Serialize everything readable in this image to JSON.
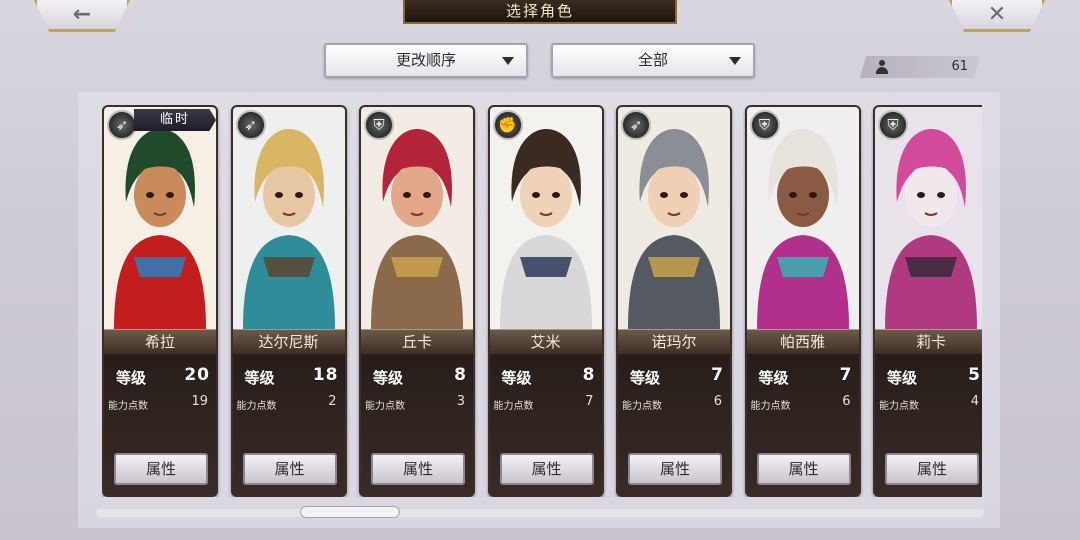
{
  "header": {
    "title": "选择角色",
    "back_icon": "←",
    "close_icon": "✕"
  },
  "controls": {
    "order_label": "更改顺序",
    "filter_label": "全部",
    "character_count": "61"
  },
  "characters": [
    {
      "name": "希拉",
      "level_label": "等级",
      "level": "20",
      "points_label": "能力点数",
      "points": "19",
      "attr_label": "属性",
      "class_icon": "bow-icon",
      "badge": "临时",
      "palette": {
        "bg": "#f5efe6",
        "hair": "#1f4a2c",
        "skin": "#c98a5c",
        "cloth": "#c21e1e",
        "accent": "#2a7fc0"
      }
    },
    {
      "name": "达尔尼斯",
      "level_label": "等级",
      "level": "18",
      "points_label": "能力点数",
      "points": "2",
      "attr_label": "属性",
      "class_icon": "bow-icon",
      "palette": {
        "bg": "#eef0f0",
        "hair": "#d9b664",
        "skin": "#e8c7a4",
        "cloth": "#2f8d9a",
        "accent": "#5b4632"
      }
    },
    {
      "name": "丘卡",
      "level_label": "等级",
      "level": "8",
      "points_label": "能力点数",
      "points": "3",
      "attr_label": "属性",
      "class_icon": "shield-icon",
      "palette": {
        "bg": "#f2ece4",
        "hair": "#b3243a",
        "skin": "#e3a88a",
        "cloth": "#8a6a4a",
        "accent": "#c9a14a"
      }
    },
    {
      "name": "艾米",
      "level_label": "等级",
      "level": "8",
      "points_label": "能力点数",
      "points": "7",
      "attr_label": "属性",
      "class_icon": "fist-icon",
      "palette": {
        "bg": "#f4f2ee",
        "hair": "#3a2a22",
        "skin": "#f0d2b8",
        "cloth": "#d8d8d8",
        "accent": "#2b3a5a"
      }
    },
    {
      "name": "诺玛尔",
      "level_label": "等级",
      "level": "7",
      "points_label": "能力点数",
      "points": "6",
      "attr_label": "属性",
      "class_icon": "bow-icon",
      "palette": {
        "bg": "#efeae2",
        "hair": "#8a8f96",
        "skin": "#f0d0b4",
        "cloth": "#555a60",
        "accent": "#c9a14a"
      }
    },
    {
      "name": "帕西雅",
      "level_label": "等级",
      "level": "7",
      "points_label": "能力点数",
      "points": "6",
      "attr_label": "属性",
      "class_icon": "shield-icon",
      "palette": {
        "bg": "#f1eef0",
        "hair": "#e6e2dc",
        "skin": "#8a5a44",
        "cloth": "#b0308c",
        "accent": "#3ab0b0"
      }
    },
    {
      "name": "莉卡",
      "level_label": "等级",
      "level": "5",
      "points_label": "能力点数",
      "points": "4",
      "attr_label": "属性",
      "class_icon": "shield-icon",
      "palette": {
        "bg": "#e9e2ea",
        "hair": "#d24a9a",
        "skin": "#f0e8ec",
        "cloth": "#b03a80",
        "accent": "#3a2a3a"
      }
    }
  ]
}
